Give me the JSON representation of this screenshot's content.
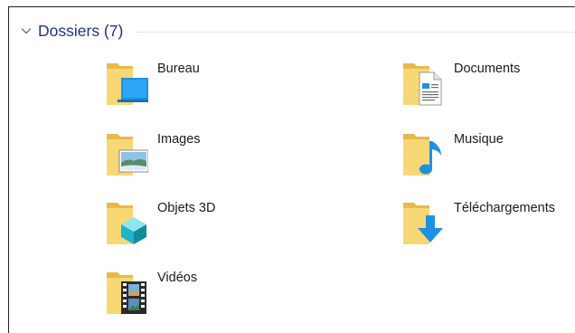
{
  "group": {
    "title": "Dossiers (7)"
  },
  "folders": [
    {
      "label": "Bureau",
      "icon": "desktop-folder-icon"
    },
    {
      "label": "Documents",
      "icon": "documents-folder-icon"
    },
    {
      "label": "Images",
      "icon": "pictures-folder-icon"
    },
    {
      "label": "Musique",
      "icon": "music-folder-icon"
    },
    {
      "label": "Objets 3D",
      "icon": "3d-objects-folder-icon"
    },
    {
      "label": "Téléchargements",
      "icon": "downloads-folder-icon"
    },
    {
      "label": "Vidéos",
      "icon": "videos-folder-icon"
    }
  ],
  "colors": {
    "group_title": "#1e3287",
    "folder_body": "#f8d775",
    "folder_back": "#e8b94a",
    "accent_blue": "#1e90e6"
  }
}
